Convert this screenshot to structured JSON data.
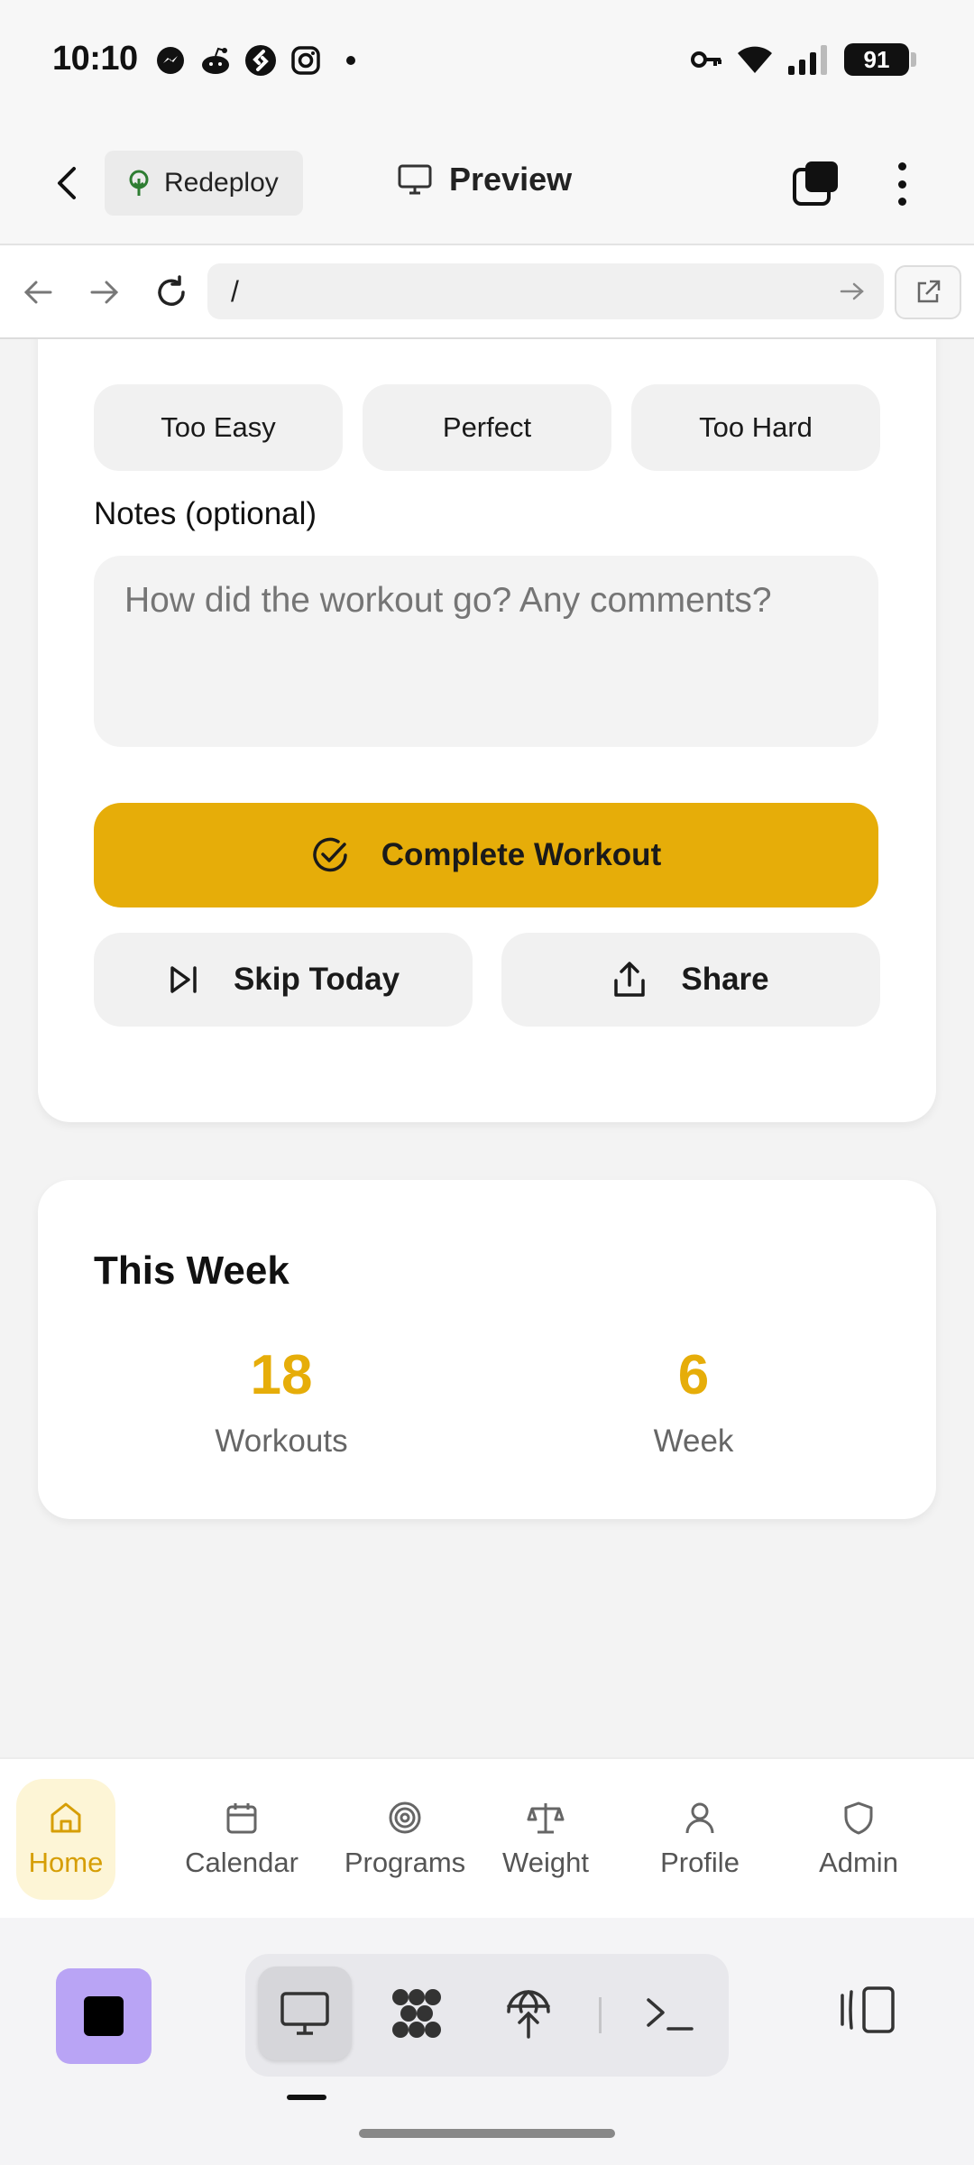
{
  "status_bar": {
    "time": "10:10",
    "notification_icons": [
      "messenger-icon",
      "reddit-icon",
      "shazam-icon",
      "instagram-icon",
      "dot-icon"
    ],
    "status_icons": [
      "vpn-key-icon",
      "wifi-icon",
      "signal-icon"
    ],
    "battery": "91"
  },
  "header": {
    "redeploy_label": "Redeploy",
    "preview_label": "Preview"
  },
  "url_bar": {
    "url": "/"
  },
  "feedback": {
    "options": [
      "Too Easy",
      "Perfect",
      "Too Hard"
    ]
  },
  "notes": {
    "label": "Notes (optional)",
    "placeholder": "How did the workout go? Any comments?"
  },
  "actions": {
    "complete_label": "Complete Workout",
    "skip_label": "Skip Today",
    "share_label": "Share"
  },
  "this_week": {
    "title": "This Week",
    "stats": [
      {
        "value": "18",
        "label": "Workouts"
      },
      {
        "value": "6",
        "label": "Week"
      }
    ]
  },
  "bottom_nav": {
    "items": [
      {
        "label": "Home",
        "icon": "home-icon",
        "active": true
      },
      {
        "label": "Calendar",
        "icon": "calendar-icon",
        "active": false
      },
      {
        "label": "Programs",
        "icon": "target-icon",
        "active": false
      },
      {
        "label": "Weight",
        "icon": "scale-icon",
        "active": false
      },
      {
        "label": "Profile",
        "icon": "user-icon",
        "active": false
      },
      {
        "label": "Admin",
        "icon": "shield-icon",
        "active": false
      }
    ]
  },
  "colors": {
    "accent": "#e6ad09",
    "active_nav_bg": "#fdf5d6",
    "stop_button": "#b9a4f5"
  }
}
